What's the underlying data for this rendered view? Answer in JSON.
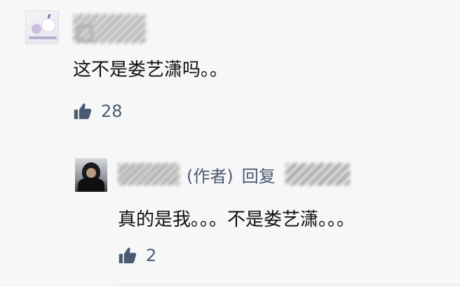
{
  "comment": {
    "text": "这不是娄艺潇吗。。",
    "likes": "28",
    "like_icon": "thumbs-up-icon"
  },
  "reply": {
    "author_tag": "(作者)",
    "reply_word": "回复",
    "text": "真的是我。。。不是娄艺潇。。。",
    "likes": "2",
    "like_icon": "thumbs-up-icon"
  },
  "colors": {
    "meta": "#4b5a73",
    "text": "#111111",
    "background": "#f7f7f7"
  }
}
